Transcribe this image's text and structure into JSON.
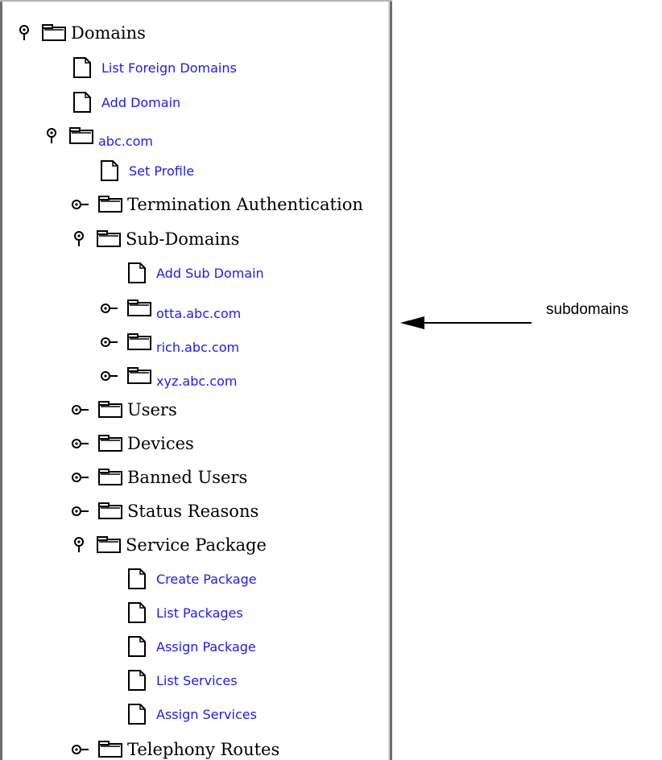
{
  "tree": {
    "root": {
      "label": "Domains"
    },
    "list_foreign_domains": {
      "label": "List Foreign Domains"
    },
    "add_domain": {
      "label": "Add Domain"
    },
    "abc": {
      "label": "abc.com"
    },
    "set_profile": {
      "label": "Set Profile"
    },
    "termination_auth": {
      "label": "Termination Authentication"
    },
    "sub_domains": {
      "label": "Sub-Domains"
    },
    "add_sub_domain": {
      "label": "Add Sub Domain"
    },
    "otta": {
      "label": "otta.abc.com"
    },
    "rich": {
      "label": "rich.abc.com"
    },
    "xyz": {
      "label": "xyz.abc.com"
    },
    "users": {
      "label": "Users"
    },
    "devices": {
      "label": "Devices"
    },
    "banned_users": {
      "label": "Banned Users"
    },
    "status_reasons": {
      "label": "Status Reasons"
    },
    "service_package": {
      "label": "Service Package"
    },
    "create_package": {
      "label": "Create Package"
    },
    "list_packages": {
      "label": "List Packages"
    },
    "assign_package": {
      "label": "Assign Package"
    },
    "list_services": {
      "label": "List Services"
    },
    "assign_services": {
      "label": "Assign Services"
    },
    "telephony_routes": {
      "label": "Telephony Routes"
    }
  },
  "annotation": {
    "label": "subdomains"
  },
  "colors": {
    "link": "#1a1aff",
    "text": "#000000",
    "border": "#6e6e6e"
  }
}
